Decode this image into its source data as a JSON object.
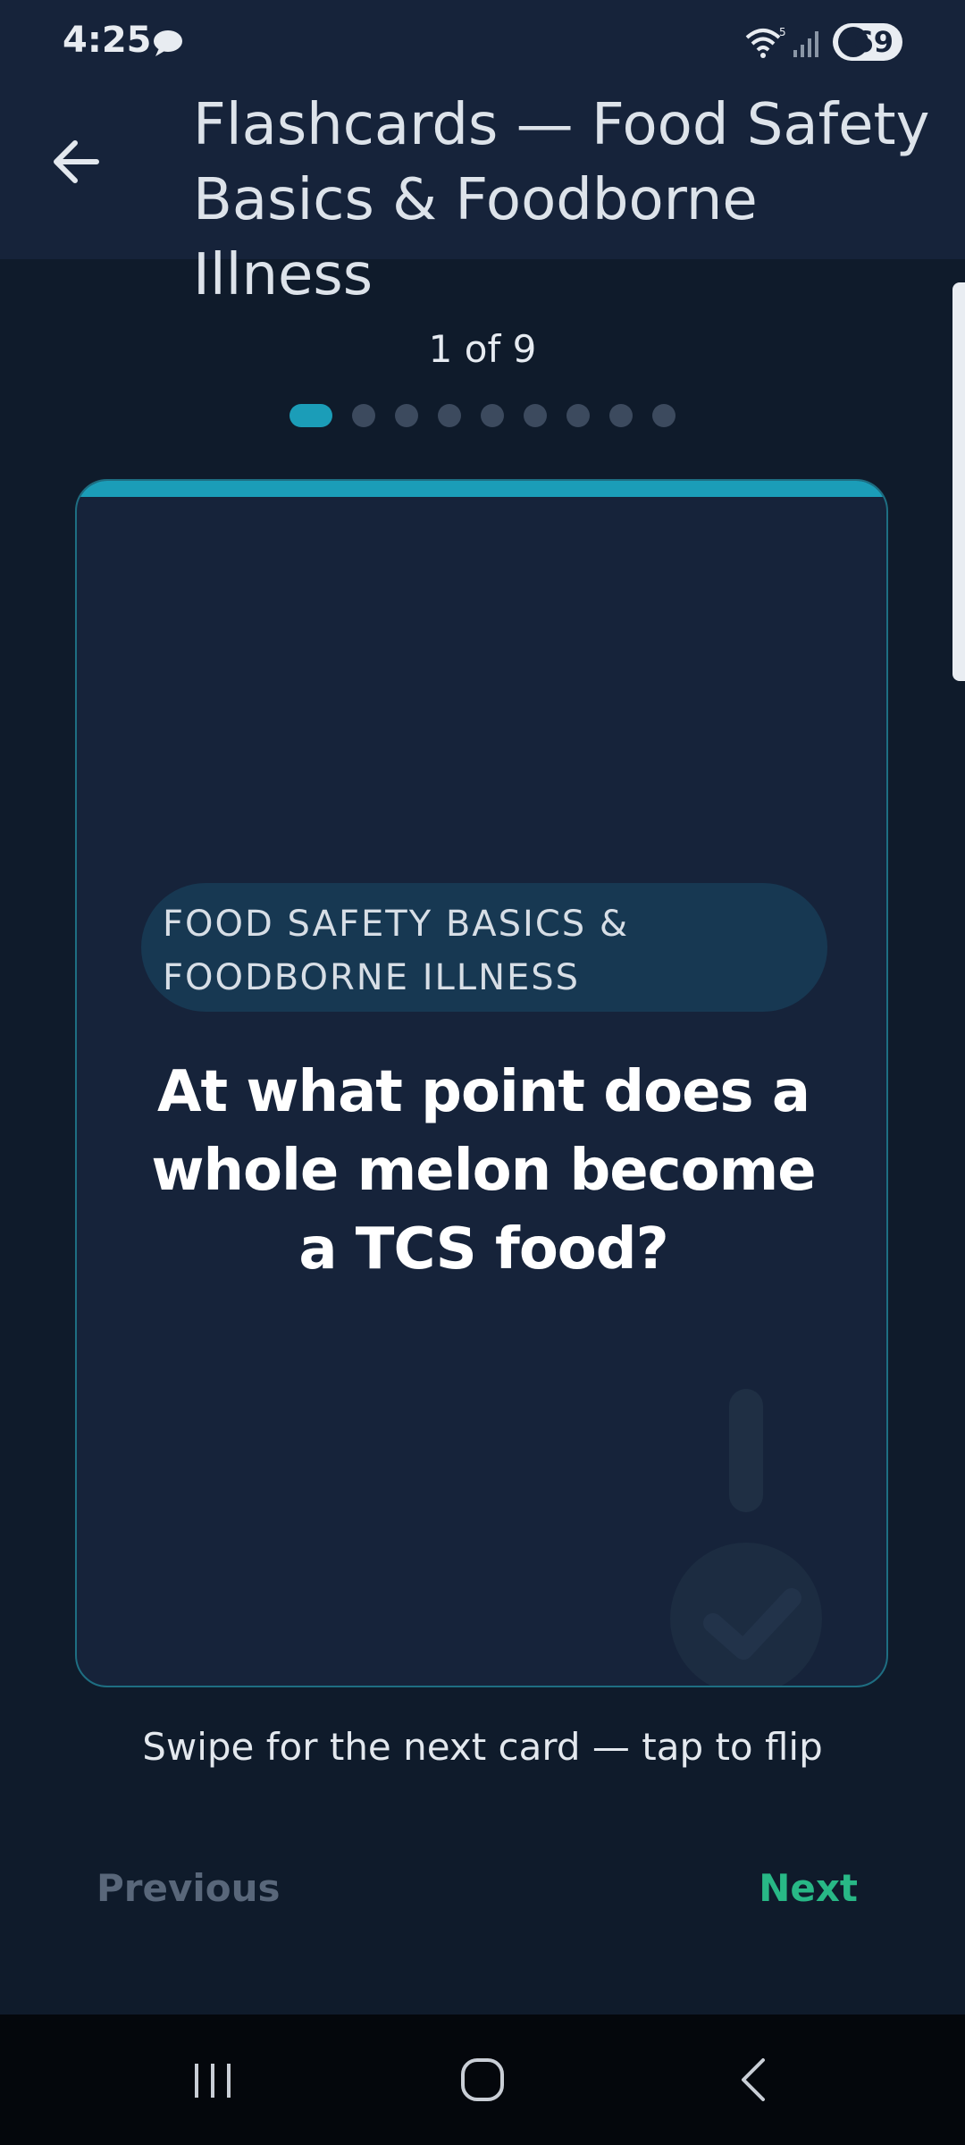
{
  "status_bar": {
    "time": "4:25",
    "battery": "69",
    "wifi_label": "5"
  },
  "header": {
    "title": "Flashcards — Food Safety Basics & Foodborne Illness"
  },
  "progress": {
    "text": "1 of 9",
    "current": 1,
    "total": 9
  },
  "card": {
    "category": "FOOD SAFETY BASICS & FOODBORNE ILLNESS",
    "question": "At what point does a whole melon become a TCS food?"
  },
  "hint": "Swipe for the next card — tap to flip",
  "nav": {
    "previous_label": "Previous",
    "next_label": "Next"
  },
  "colors": {
    "accent": "#1b9db8",
    "next": "#28b886",
    "background": "#0f1b2b",
    "card": "#16233a"
  },
  "icons": [
    "chat-bubble-icon",
    "wifi-icon",
    "signal-icon",
    "battery-icon",
    "back-arrow-icon",
    "check-icon",
    "recents-icon",
    "home-icon",
    "system-back-icon"
  ]
}
